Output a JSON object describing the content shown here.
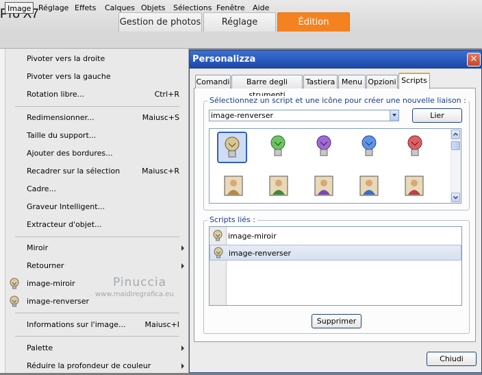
{
  "app": {
    "title": "Pro X7",
    "workspace_tabs": [
      {
        "label": "Gestion de photos"
      },
      {
        "label": "Réglage"
      },
      {
        "label": "Édition",
        "active": true
      }
    ]
  },
  "menubar": {
    "items": [
      {
        "label": "Image",
        "open": true
      },
      {
        "label": "Réglage"
      },
      {
        "label": "Effets"
      },
      {
        "label": "Calques"
      },
      {
        "label": "Objets"
      },
      {
        "label": "Sélections"
      },
      {
        "label": "Fenêtre"
      },
      {
        "label": "Aide"
      }
    ]
  },
  "image_menu": {
    "items": [
      {
        "label": "Pivoter vers la droite",
        "shortcut": ""
      },
      {
        "label": "Pivoter vers la gauche",
        "shortcut": ""
      },
      {
        "label": "Rotation libre...",
        "shortcut": "Ctrl+R"
      },
      {
        "label": "Redimensionner...",
        "shortcut": "Maiusc+S"
      },
      {
        "label": "Taille du support...",
        "shortcut": ""
      },
      {
        "label": "Ajouter des bordures...",
        "shortcut": ""
      },
      {
        "label": "Recadrer sur la sélection",
        "shortcut": "Maiusc+R"
      },
      {
        "label": "Cadre...",
        "shortcut": ""
      },
      {
        "label": "Graveur Intelligent...",
        "shortcut": ""
      },
      {
        "label": "Extracteur d'objet...",
        "shortcut": ""
      },
      {
        "label": "Miroir",
        "submenu": true
      },
      {
        "label": "Retourner",
        "submenu": true
      },
      {
        "label": "image-miroir",
        "icon": "script-bulb-icon"
      },
      {
        "label": "image-renverser",
        "icon": "script-bulb-icon"
      },
      {
        "label": "Informations sur l'image...",
        "shortcut": "Maiusc+I"
      },
      {
        "label": "Palette",
        "submenu": true
      },
      {
        "label": "Réduire la profondeur de couleur",
        "submenu": true
      }
    ]
  },
  "watermark": {
    "line1": "Pinuccia",
    "line2": "www.maidiregrafica.eu"
  },
  "dialog": {
    "title": "Personalizza",
    "close_label": "✕",
    "tabs": [
      {
        "label": "Comandi"
      },
      {
        "label": "Barre degli strumenti"
      },
      {
        "label": "Tastiera"
      },
      {
        "label": "Menu"
      },
      {
        "label": "Opzioni"
      },
      {
        "label": "Scripts",
        "active": true
      }
    ],
    "select_group_caption": "Sélectionnez un script et une icône pour créer une nouvelle liaison :",
    "script_select_value": "image-renverser",
    "link_button": "Lier",
    "linked_group_caption": "Scripts liés :",
    "linked_scripts": [
      {
        "label": "image-miroir"
      },
      {
        "label": "image-renverser",
        "selected": true
      }
    ],
    "delete_button": "Supprimer",
    "close_button": "Chiudi"
  },
  "colors": {
    "accent_tab": "#f58220",
    "dialog_title": "#1c46a6",
    "bulb_colors": [
      "#c9b98a",
      "#5fbf5a",
      "#9a5fd0",
      "#5a8ee6",
      "#d95a60"
    ]
  }
}
